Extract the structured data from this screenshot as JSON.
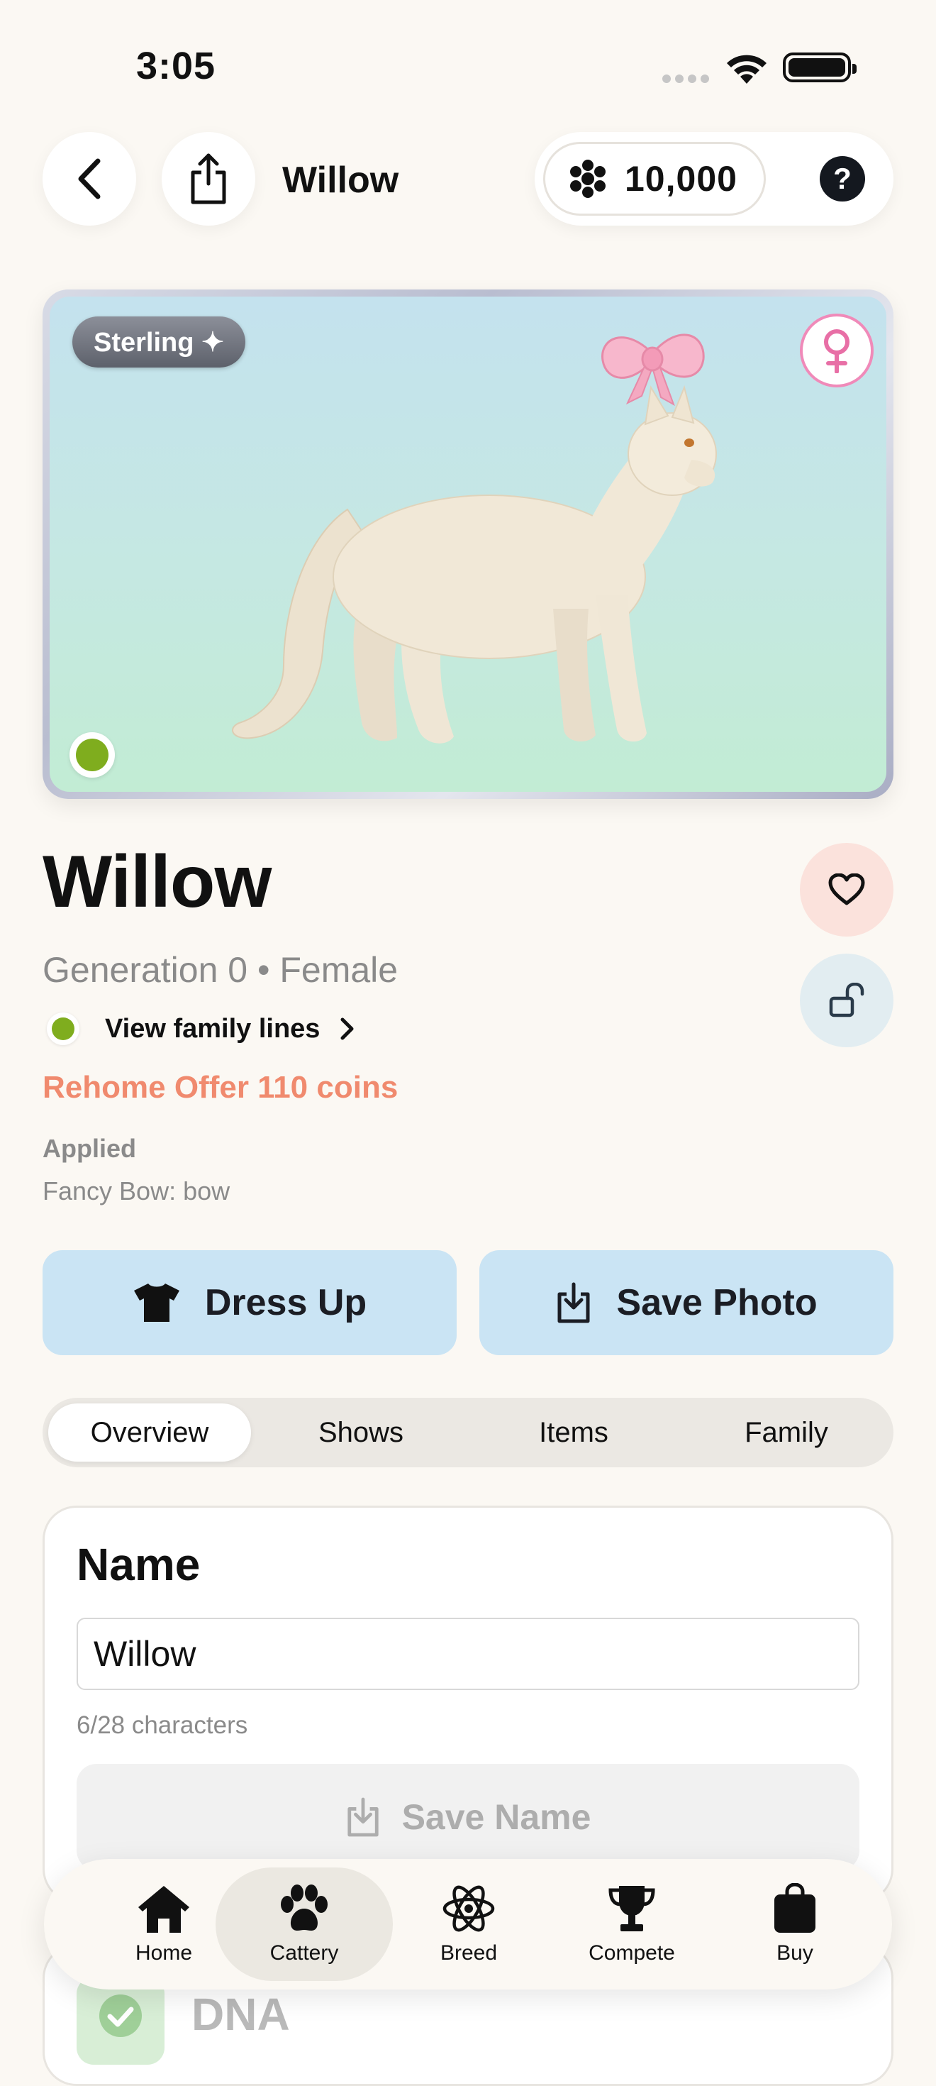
{
  "status_bar": {
    "time": "3:05"
  },
  "header": {
    "title": "Willow",
    "coins": "10,000",
    "help": "?"
  },
  "photo": {
    "tier_badge": "Sterling ✦",
    "gender": "female"
  },
  "cat": {
    "name": "Willow",
    "subtitle": "Generation 0 • Female",
    "family_link": "View family lines",
    "rehome_offer": "Rehome Offer 110 coins",
    "applied_label": "Applied",
    "applied_item": "Fancy Bow: bow"
  },
  "actions": {
    "dress_up": "Dress Up",
    "save_photo": "Save Photo"
  },
  "tabs": [
    {
      "label": "Overview",
      "active": true
    },
    {
      "label": "Shows",
      "active": false
    },
    {
      "label": "Items",
      "active": false
    },
    {
      "label": "Family",
      "active": false
    }
  ],
  "name_card": {
    "title": "Name",
    "input_value": "Willow",
    "char_count": "6/28 characters",
    "save_label": "Save Name"
  },
  "dna_card": {
    "title": "DNA"
  },
  "bottom_nav": [
    {
      "label": "Home",
      "icon": "home-icon",
      "active": false
    },
    {
      "label": "Cattery",
      "icon": "paw-icon",
      "active": true
    },
    {
      "label": "Breed",
      "icon": "atom-icon",
      "active": false
    },
    {
      "label": "Compete",
      "icon": "trophy-icon",
      "active": false
    },
    {
      "label": "Buy",
      "icon": "bag-icon",
      "active": false
    }
  ],
  "colors": {
    "background": "#fbf8f3",
    "accent_button": "#cae4f4",
    "rehome_text": "#f08a6e",
    "status_green": "#7fad1e",
    "female_pink": "#f08ab9"
  }
}
